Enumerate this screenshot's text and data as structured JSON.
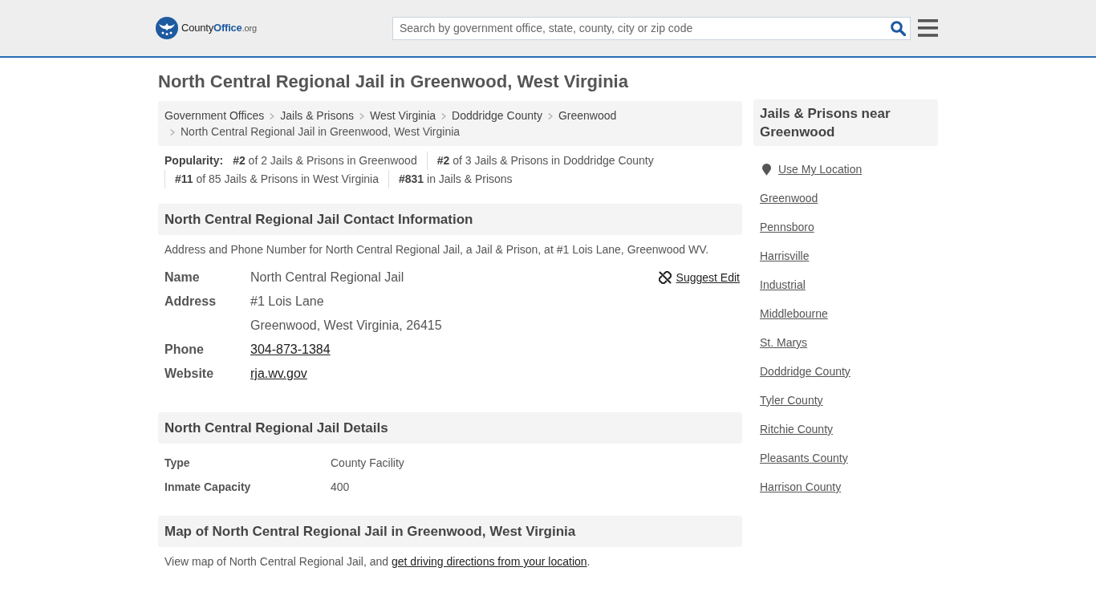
{
  "header": {
    "logo_text": [
      "County",
      "Office",
      ".org"
    ],
    "search": {
      "placeholder": "Search by government office, state, county, city or zip code"
    }
  },
  "title": "North Central Regional Jail in Greenwood, West Virginia",
  "breadcrumb": {
    "links": [
      "Government Offices",
      "Jails & Prisons",
      "West Virginia",
      "Doddridge County",
      "Greenwood"
    ],
    "current": "North Central Regional Jail in Greenwood, West Virginia"
  },
  "popularity": {
    "label": "Popularity:",
    "ranks": [
      "**#2** of 2 Jails & Prisons in Greenwood",
      "**#2** of 3 Jails & Prisons in Doddridge County",
      "**#11** of 85 Jails & Prisons in West Virginia",
      "**#831** in Jails & Prisons"
    ]
  },
  "contact": {
    "heading": "North Central Regional Jail Contact Information",
    "description": "Address and Phone Number for North Central Regional Jail, a Jail & Prison, at #1 Lois Lane, Greenwood WV.",
    "suggest_edit": "Suggest Edit",
    "fields": [
      {
        "label": "Name",
        "kind": "text",
        "lines": [
          "North Central Regional Jail"
        ]
      },
      {
        "label": "Address",
        "kind": "text",
        "lines": [
          "#1 Lois Lane",
          "Greenwood, West Virginia, 26415"
        ]
      },
      {
        "label": "Phone",
        "kind": "link",
        "lines": [
          "304-873-1384"
        ]
      },
      {
        "label": "Website",
        "kind": "link",
        "lines": [
          "rja.wv.gov"
        ]
      }
    ]
  },
  "details": {
    "heading": "North Central Regional Jail Details",
    "rows": [
      {
        "label": "Type",
        "value": "County Facility"
      },
      {
        "label": "Inmate Capacity",
        "value": "400"
      }
    ]
  },
  "map": {
    "heading": "Map of North Central Regional Jail in Greenwood, West Virginia",
    "text": "View map of North Central Regional Jail, and ",
    "link": "get driving directions from your location",
    "tail": "."
  },
  "sidebar": {
    "heading": "Jails & Prisons near Greenwood",
    "use_location": "Use My Location",
    "links": [
      "Greenwood",
      "Pennsboro",
      "Harrisville",
      "Industrial",
      "Middlebourne",
      "St. Marys",
      "Doddridge County",
      "Tyler County",
      "Ritchie County",
      "Pleasants County",
      "Harrison County"
    ]
  }
}
